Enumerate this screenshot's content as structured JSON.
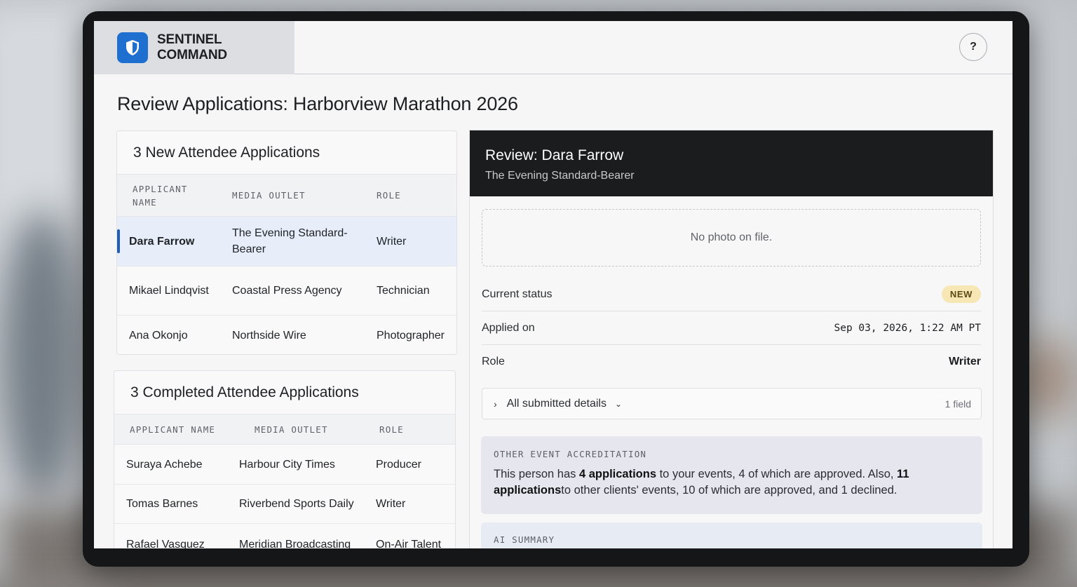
{
  "app": {
    "brand_line1": "SENTINEL",
    "brand_line2": "COMMAND",
    "help_label": "?"
  },
  "page": {
    "title": "Review Applications: Harborview Marathon 2026"
  },
  "new_applications": {
    "heading": "3 New Attendee Applications",
    "columns": [
      "APPLICANT NAME",
      "MEDIA OUTLET",
      "ROLE"
    ],
    "rows": [
      {
        "name": "Dara Farrow",
        "outlet": "The Evening Standard-Bearer",
        "role": "Writer",
        "selected": true
      },
      {
        "name": "Mikael Lindqvist",
        "outlet": "Coastal Press Agency",
        "role": "Technician",
        "selected": false
      },
      {
        "name": "Ana Okonjo",
        "outlet": "Northside Wire",
        "role": "Photographer",
        "selected": false
      }
    ]
  },
  "completed_applications": {
    "heading": "3 Completed Attendee Applications",
    "columns": [
      "APPLICANT NAME",
      "MEDIA OUTLET",
      "ROLE"
    ],
    "rows": [
      {
        "name": "Suraya Achebe",
        "outlet": "Harbour City Times",
        "role": "Producer"
      },
      {
        "name": "Tomas Barnes",
        "outlet": "Riverbend Sports Daily",
        "role": "Writer"
      },
      {
        "name": "Rafael Vasquez",
        "outlet": "Meridian Broadcasting",
        "role": "On-Air Talent"
      }
    ]
  },
  "review": {
    "title": "Review: Dara Farrow",
    "subtitle": "The Evening Standard-Bearer",
    "photo_placeholder": "No photo on file.",
    "status_label": "Current status",
    "status_value": "NEW",
    "applied_label": "Applied on",
    "applied_value": "Sep 03, 2026, 1:22 AM PT",
    "role_label": "Role",
    "role_value": "Writer",
    "details_toggle": "All submitted details",
    "details_count": "1 field",
    "other_label": "OTHER EVENT ACCREDITATION",
    "other_text": {
      "p1": "This person has ",
      "b1": "4 applications",
      "p2": " to your events, 4 of which are approved. Also, ",
      "b2": "11 applications",
      "p3": "to other clients' events, 10 of which are approved, and 1 declined."
    },
    "ai_label": "AI SUMMARY"
  },
  "colors": {
    "accent": "#1f6fd1",
    "selected_row": "#e7eef9",
    "status_badge": "#f7e7b4",
    "review_header": "#1b1c1e"
  }
}
